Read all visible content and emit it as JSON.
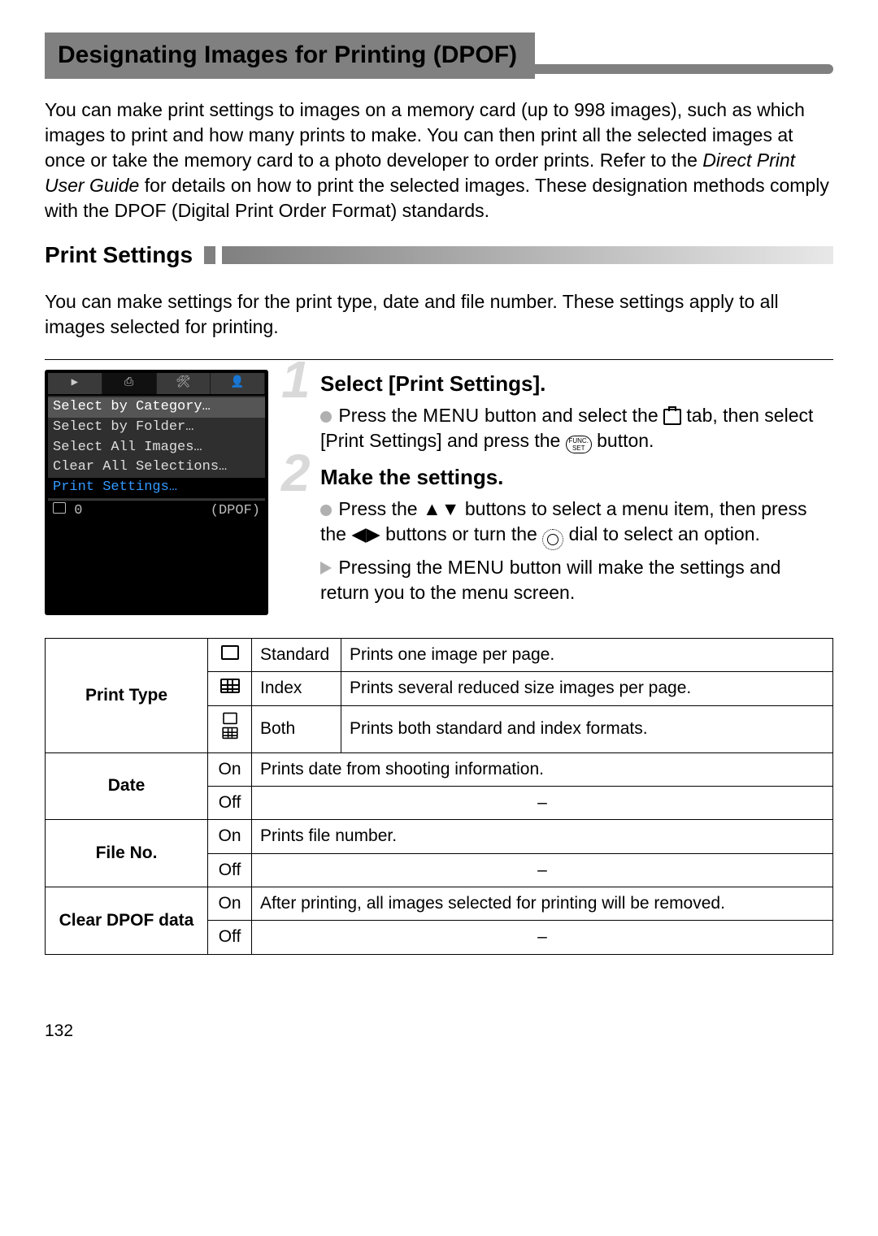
{
  "title": "Designating Images for Printing (DPOF)",
  "intro_a": "You can make print settings to images on a memory card (up to 998 images), such as which images to print and how many prints to make. You can then print all the selected images at once or take the memory card to a photo developer to order prints. Refer to the ",
  "intro_em": "Direct Print User Guide",
  "intro_b": " for details on how to print the selected images. These designation methods comply with the DPOF (Digital Print Order Format) standards.",
  "subhead": "Print Settings",
  "sub_intro": "You can make settings for the print type, date and file number. These settings apply to all images selected for printing.",
  "cam": {
    "items": [
      "Select by Category…",
      "Select by Folder…",
      "Select All Images…",
      "Clear All Selections…",
      "Print Settings…"
    ],
    "footer_left": "0",
    "footer_right": "(DPOF)"
  },
  "steps": {
    "s1_num": "1",
    "s1_title": "Select [Print Settings].",
    "s1_a": "Press the ",
    "s1_menu": "MENU",
    "s1_b": " button and select the ",
    "s1_c": " tab, then select [Print Settings] and press the ",
    "s1_d": " button.",
    "func_label": "FUNC.\nSET",
    "s2_num": "2",
    "s2_title": "Make the settings.",
    "s2_a": "Press the ",
    "s2_b": " buttons to select a menu item, then press the ",
    "s2_c": " buttons or turn the ",
    "s2_d": " dial to select an option.",
    "s2_e": "Pressing the ",
    "s2_f": " button will make the settings and return you to the menu screen."
  },
  "table": {
    "print_type": "Print Type",
    "standard": "Standard",
    "standard_d": "Prints one image per page.",
    "index": "Index",
    "index_d": "Prints several reduced size images per page.",
    "both": "Both",
    "both_d": "Prints both standard and index formats.",
    "date": "Date",
    "on": "On",
    "off": "Off",
    "date_on": "Prints date from shooting information.",
    "dash": "–",
    "fileno": "File No.",
    "fileno_on": "Prints file number.",
    "clear": "Clear DPOF data",
    "clear_on": "After printing, all images selected for printing will be removed."
  },
  "page_number": "132"
}
